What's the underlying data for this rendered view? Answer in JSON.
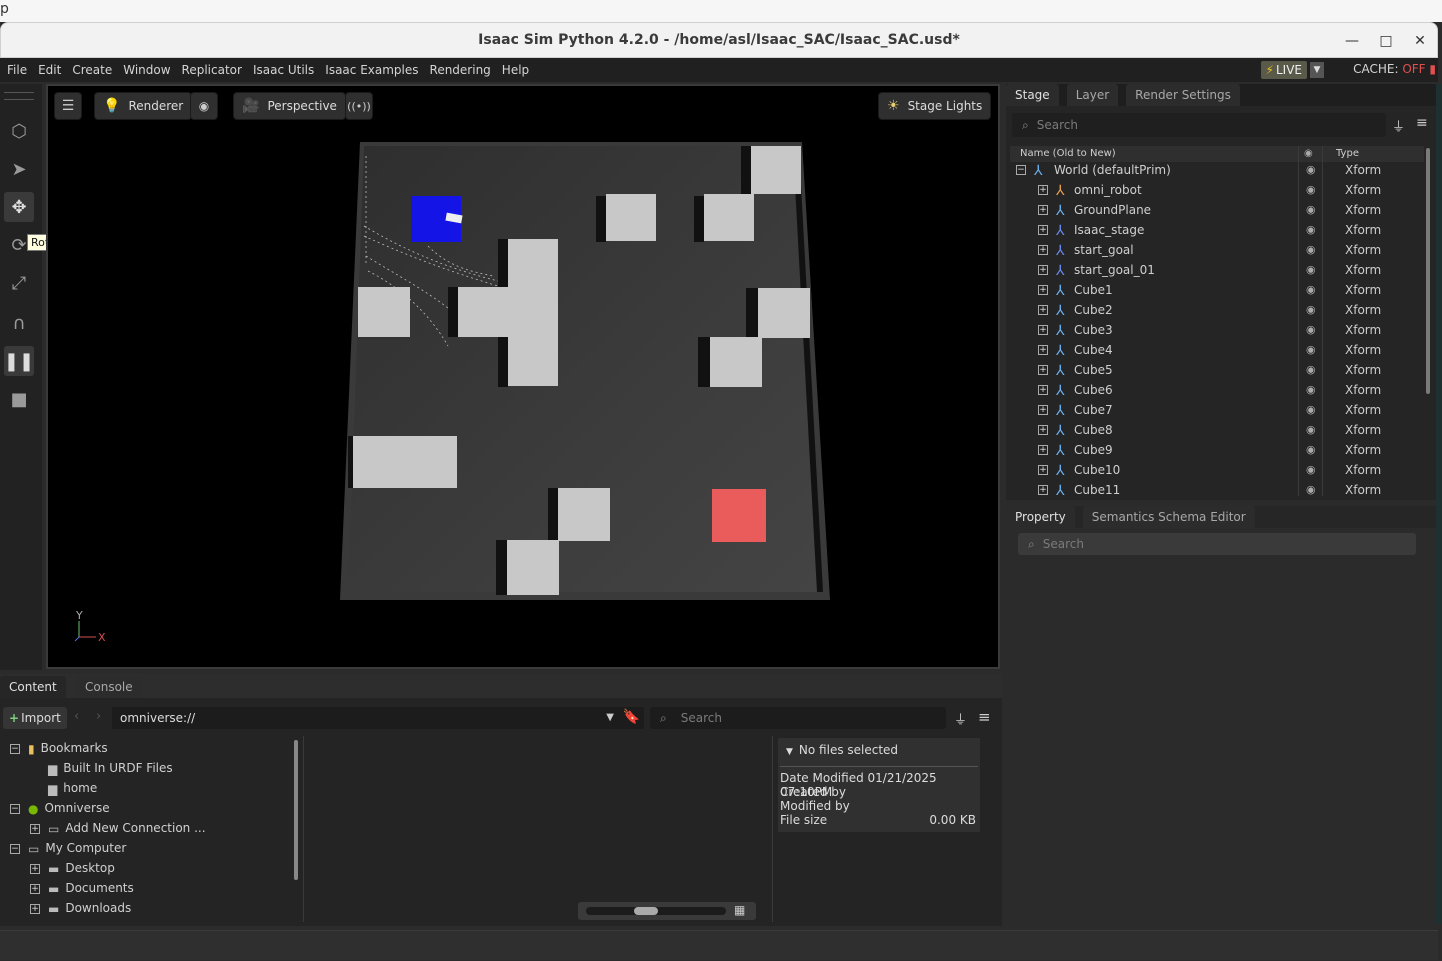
{
  "top_strip": {
    "text": "p"
  },
  "window": {
    "title": "Isaac Sim Python 4.2.0 - /home/asl/Isaac_SAC/Isaac_SAC.usd*",
    "minimize": "—",
    "maximize": "□",
    "close": "✕"
  },
  "menubar": {
    "items": [
      "File",
      "Edit",
      "Create",
      "Window",
      "Replicator",
      "Isaac Utils",
      "Isaac Examples",
      "Rendering",
      "Help"
    ]
  },
  "status": {
    "live_label": "LIVE",
    "cache_label": "CACHE:",
    "cache_state": "OFF"
  },
  "toolbar": {
    "tooltip": "Rotate (E)"
  },
  "viewport": {
    "renderer_label": "Renderer",
    "camera_label": "Perspective",
    "lights_label": "Stage Lights",
    "axis_y": "Y",
    "axis_x": "X"
  },
  "stage": {
    "tabs": [
      "Stage",
      "Layer",
      "Render Settings"
    ],
    "search_placeholder": "Search",
    "col_name": "Name (Old to New)",
    "col_type": "Type",
    "rows": [
      {
        "name": "World (defaultPrim)",
        "type": "Xform"
      },
      {
        "name": "omni_robot",
        "type": "Xform"
      },
      {
        "name": "GroundPlane",
        "type": "Xform"
      },
      {
        "name": "Isaac_stage",
        "type": "Xform"
      },
      {
        "name": "start_goal",
        "type": "Xform"
      },
      {
        "name": "start_goal_01",
        "type": "Xform"
      },
      {
        "name": "Cube1",
        "type": "Xform"
      },
      {
        "name": "Cube2",
        "type": "Xform"
      },
      {
        "name": "Cube3",
        "type": "Xform"
      },
      {
        "name": "Cube4",
        "type": "Xform"
      },
      {
        "name": "Cube5",
        "type": "Xform"
      },
      {
        "name": "Cube6",
        "type": "Xform"
      },
      {
        "name": "Cube7",
        "type": "Xform"
      },
      {
        "name": "Cube8",
        "type": "Xform"
      },
      {
        "name": "Cube9",
        "type": "Xform"
      },
      {
        "name": "Cube10",
        "type": "Xform"
      },
      {
        "name": "Cube11",
        "type": "Xform"
      }
    ]
  },
  "property": {
    "tabs": [
      "Property",
      "Semantics Schema Editor"
    ],
    "search_placeholder": "Search"
  },
  "content": {
    "tabs": [
      "Content",
      "Console"
    ],
    "import_label": "Import",
    "path": "omniverse://",
    "search_placeholder": "Search",
    "tree": [
      {
        "label": "Bookmarks"
      },
      {
        "label": "Built In URDF Files"
      },
      {
        "label": "home"
      },
      {
        "label": "Omniverse"
      },
      {
        "label": "Add New Connection ..."
      },
      {
        "label": "My Computer"
      },
      {
        "label": "Desktop"
      },
      {
        "label": "Documents"
      },
      {
        "label": "Downloads"
      }
    ],
    "details": {
      "header": "No files selected",
      "date_modified_label": "Date Modified",
      "date_modified": "01/21/2025 07:10PM",
      "created_by_label": "Created by",
      "modified_by_label": "Modified by",
      "file_size_label": "File size",
      "file_size": "0.00 KB"
    }
  }
}
